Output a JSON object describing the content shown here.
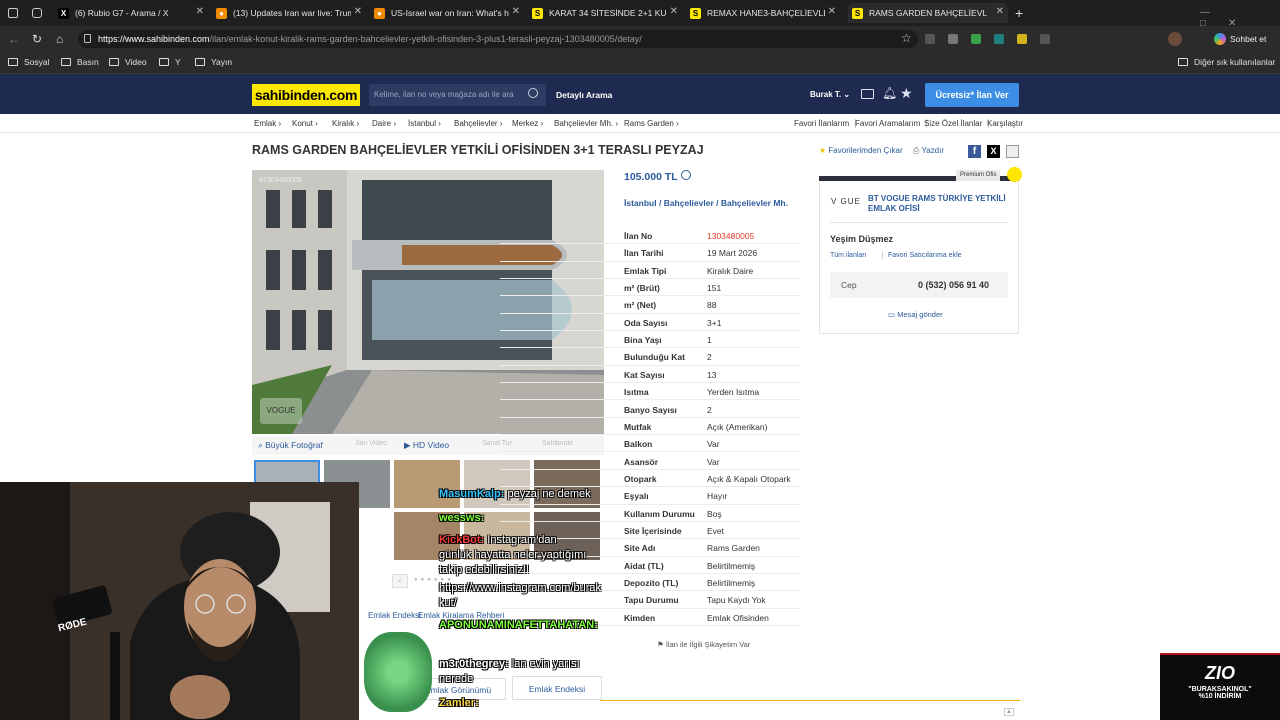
{
  "browser": {
    "tabs": [
      {
        "title": "Rubio G7 - Arama / X",
        "prefix": "(6)",
        "icon": "x-logo-icon",
        "color": "#000000",
        "glyph": "X"
      },
      {
        "title": "Updates Iran war live: Trump ...",
        "prefix": "(13)",
        "icon": "news-icon",
        "color": "#f08a00",
        "glyph": "●"
      },
      {
        "title": "US-Israel war on Iran: What's happ...",
        "prefix": "",
        "icon": "news-icon",
        "color": "#f08a00",
        "glyph": "●"
      },
      {
        "title": "KARAT 34 SİTESİNDE 2+1 KULLAN...",
        "prefix": "",
        "icon": "sahibinden-icon",
        "color": "#ffe800",
        "glyph": "S"
      },
      {
        "title": "REMAX HANE3-BAHÇELİEVLER YA...",
        "prefix": "",
        "icon": "sahibinden-icon",
        "color": "#ffe800",
        "glyph": "S"
      },
      {
        "title": "RAMS GARDEN BAHÇELİEVLER YE...",
        "prefix": "",
        "icon": "sahibinden-icon",
        "color": "#ffe800",
        "glyph": "S",
        "active": true
      }
    ],
    "url_host": "https://www.sahibinden.com",
    "url_path": "/ilan/emlak-konut-kiralik-rams-garden-bahcelievler-yetkili-ofisinden-3-plus1-terasli-peyzaj-1303480005/detay/",
    "chat_button": "Sohbet et",
    "bookmarks": [
      "Sosyal",
      "Basın",
      "Video",
      "Y",
      "Yayın"
    ],
    "other_bookmarks": "Diğer sık kullanılanlar"
  },
  "site": {
    "logo": "sahibinden.com",
    "search_placeholder": "Kelime, ilan no veya mağaza adı ile ara",
    "advanced_search": "Detaylı Arama",
    "user": "Burak T.",
    "post_ad_button": "Ücretsiz* İlan Ver",
    "brand_color": "#ffe800",
    "header_color": "#1e2a4f",
    "accent_color": "#3b8ee4"
  },
  "breadcrumbs": [
    "Emlak",
    "Konut",
    "Kiralık",
    "Daire",
    "İstanbul",
    "Bahçelievler",
    "Merkez",
    "Bahçelievler Mh.",
    "Rams Garden"
  ],
  "top_links": [
    "Favori İlanlarım",
    "Favori Aramalarım",
    "Size Özel İlanlar",
    "Karşılaştır"
  ],
  "listing": {
    "title": "RAMS GARDEN BAHÇELİEVLER YETKİLİ OFİSİNDEN 3+1 TERASLI PEYZAJ",
    "fav_remove": "Favorilerimden Çıkar",
    "print": "Yazdır",
    "price": "105.000 TL",
    "location": [
      "İstanbul",
      "Bahçelievler",
      "Bahçelievler Mh."
    ],
    "photo_id": "#1303480005",
    "photo_watermark": "VOGUE",
    "media_tabs": [
      "Büyük Fotoğraf",
      "İlan Video",
      "HD Video",
      "Sanal Tur",
      "Sahibinde"
    ],
    "properties": [
      {
        "k": "İlan No",
        "v": "1303480005"
      },
      {
        "k": "İlan Tarihi",
        "v": "19 Mart 2026"
      },
      {
        "k": "Emlak Tipi",
        "v": "Kiralık Daire"
      },
      {
        "k": "m² (Brüt)",
        "v": "151"
      },
      {
        "k": "m² (Net)",
        "v": "88"
      },
      {
        "k": "Oda Sayısı",
        "v": "3+1"
      },
      {
        "k": "Bina Yaşı",
        "v": "1"
      },
      {
        "k": "Bulunduğu Kat",
        "v": "2"
      },
      {
        "k": "Kat Sayısı",
        "v": "13"
      },
      {
        "k": "Isıtma",
        "v": "Yerden Isıtma"
      },
      {
        "k": "Banyo Sayısı",
        "v": "2"
      },
      {
        "k": "Mutfak",
        "v": "Açık (Amerikan)"
      },
      {
        "k": "Balkon",
        "v": "Var"
      },
      {
        "k": "Asansör",
        "v": "Var"
      },
      {
        "k": "Otopark",
        "v": "Açık & Kapalı Otopark"
      },
      {
        "k": "Eşyalı",
        "v": "Hayır"
      },
      {
        "k": "Kullanım Durumu",
        "v": "Boş"
      },
      {
        "k": "Site İçerisinde",
        "v": "Evet"
      },
      {
        "k": "Site Adı",
        "v": "Rams Garden"
      },
      {
        "k": "Aidat (TL)",
        "v": "Belirtilmemiş"
      },
      {
        "k": "Depozito (TL)",
        "v": "Belirtilmemiş"
      },
      {
        "k": "Tapu Durumu",
        "v": "Tapu Kaydı Yok"
      },
      {
        "k": "Kimden",
        "v": "Emlak Ofisinden"
      }
    ],
    "complaint": "İlan ile İlgili Şikayetim Var",
    "bottom_links": [
      "Emlak Endeksi",
      "Emlak Kiralama Rehberi"
    ],
    "bottom_tabs": [
      "Emlak Görünümü",
      "Emlak Endeksi"
    ]
  },
  "agent": {
    "badge": "Premium Ofis",
    "office_logo": "V GUE",
    "office": "BT VOGUE RAMS TÜRKİYE YETKİLİ EMLAK OFİSİ",
    "name": "Yeşim Düşmez",
    "all_ads": "Tüm ilanları",
    "fav_seller": "Favori Satıcılarıma ekle",
    "phone_label": "Cep",
    "phone": "0 (532) 056 91 40",
    "message": "Mesaj gönder"
  },
  "stream": {
    "mic_brand": "RØDE",
    "chat": [
      {
        "user": "MasumKalp:",
        "msg": "peyzaj ne demek",
        "color": "#36c6ff"
      },
      {
        "user": "wessws:",
        "msg": "",
        "color": "#7cff3a"
      },
      {
        "user": "KickBot:",
        "msg": "Instagram'dan",
        "color": "#ff3b3b"
      },
      {
        "user": "",
        "msg": "günlük hayatta neler yaptığımı",
        "color": "#ffffff"
      },
      {
        "user": "",
        "msg": "takip edebilirsiniz!!",
        "color": "#ffffff"
      },
      {
        "user": "",
        "msg": "https://www.instagram.com/burak",
        "color": "#ffffff"
      },
      {
        "user": "",
        "msg": "kut/",
        "color": "#ffffff"
      },
      {
        "user": "APONUNAMINAFETTAHATAN:",
        "msg": "",
        "color": "#7cff3a"
      },
      {
        "user": "m3r0thegrey:",
        "msg": "lan evin yarısı",
        "color": "#ffffff"
      },
      {
        "user": "",
        "msg": "nerede",
        "color": "#ffffff"
      },
      {
        "user": "Zamler:",
        "msg": "",
        "color": "#ffd84a"
      }
    ],
    "promo_brand": "ZIO",
    "promo_code": "\"BURAKSAKINOL\"",
    "promo_discount": "%10 İNDİRİM"
  }
}
